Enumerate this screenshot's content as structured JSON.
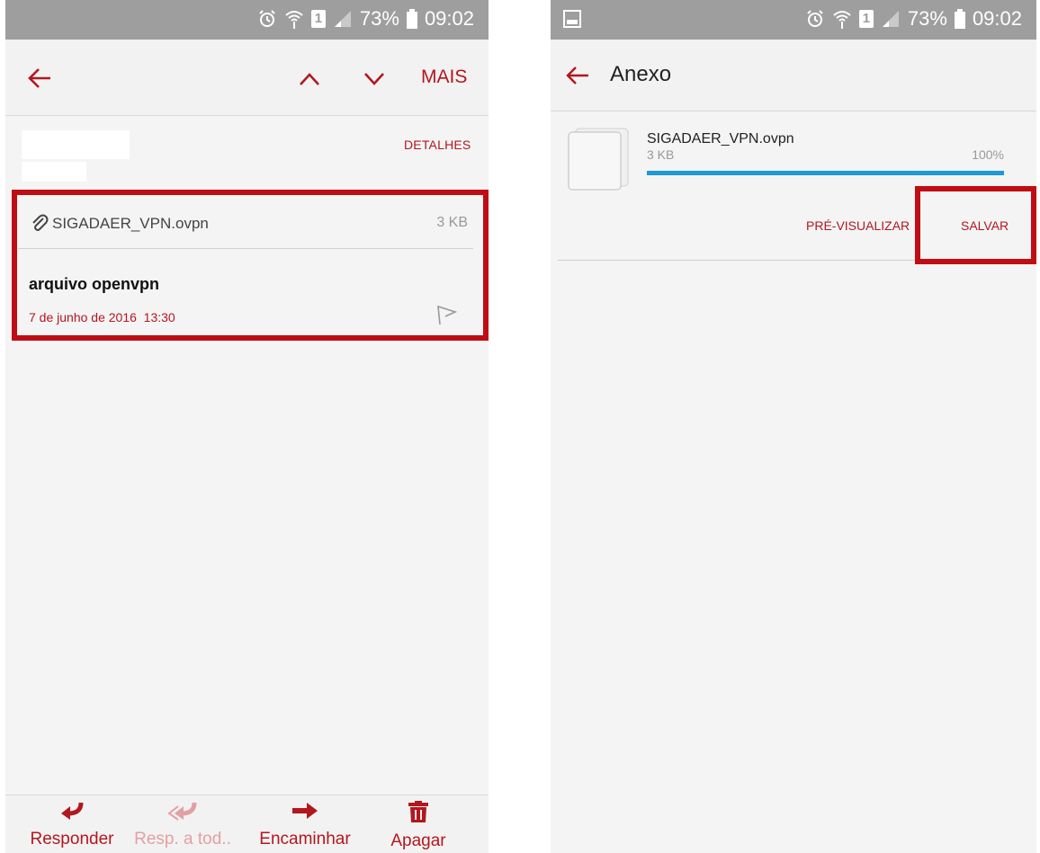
{
  "left_screen": {
    "status": {
      "battery": "73%",
      "time": "09:02",
      "sim": "1"
    },
    "appbar": {
      "more_label": "MAIS"
    },
    "header": {
      "details_label": "DETALHES"
    },
    "attachment": {
      "filename": "SIGADAER_VPN.ovpn",
      "size": "3 KB"
    },
    "message": {
      "subject": "arquivo openvpn",
      "date": "7 de junho de 2016  13:30"
    },
    "bottom_bar": {
      "reply": "Responder",
      "reply_all": "Resp. a tod..",
      "forward": "Encaminhar",
      "delete": "Apagar"
    }
  },
  "right_screen": {
    "status": {
      "battery": "73%",
      "time": "09:02",
      "sim": "1"
    },
    "appbar": {
      "title": "Anexo"
    },
    "attachment": {
      "filename": "SIGADAER_VPN.ovpn",
      "size": "3 KB",
      "progress_label": "100%",
      "progress": 1.0
    },
    "actions": {
      "preview": "PRÉ-VISUALIZAR",
      "save": "SALVAR"
    }
  },
  "colors": {
    "accent": "#b3171e",
    "highlight": "#c00d14",
    "progress": "#1e9bd7",
    "statusbar": "#9e9e9e"
  },
  "icons": [
    "alarm-icon",
    "wifi-icon",
    "sim-icon",
    "signal-icon",
    "battery-icon",
    "back-arrow-icon",
    "chevron-up-icon",
    "chevron-down-icon",
    "paperclip-icon",
    "flag-icon",
    "reply-icon",
    "reply-all-icon",
    "forward-icon",
    "trash-icon",
    "gallery-icon",
    "file-icon"
  ]
}
